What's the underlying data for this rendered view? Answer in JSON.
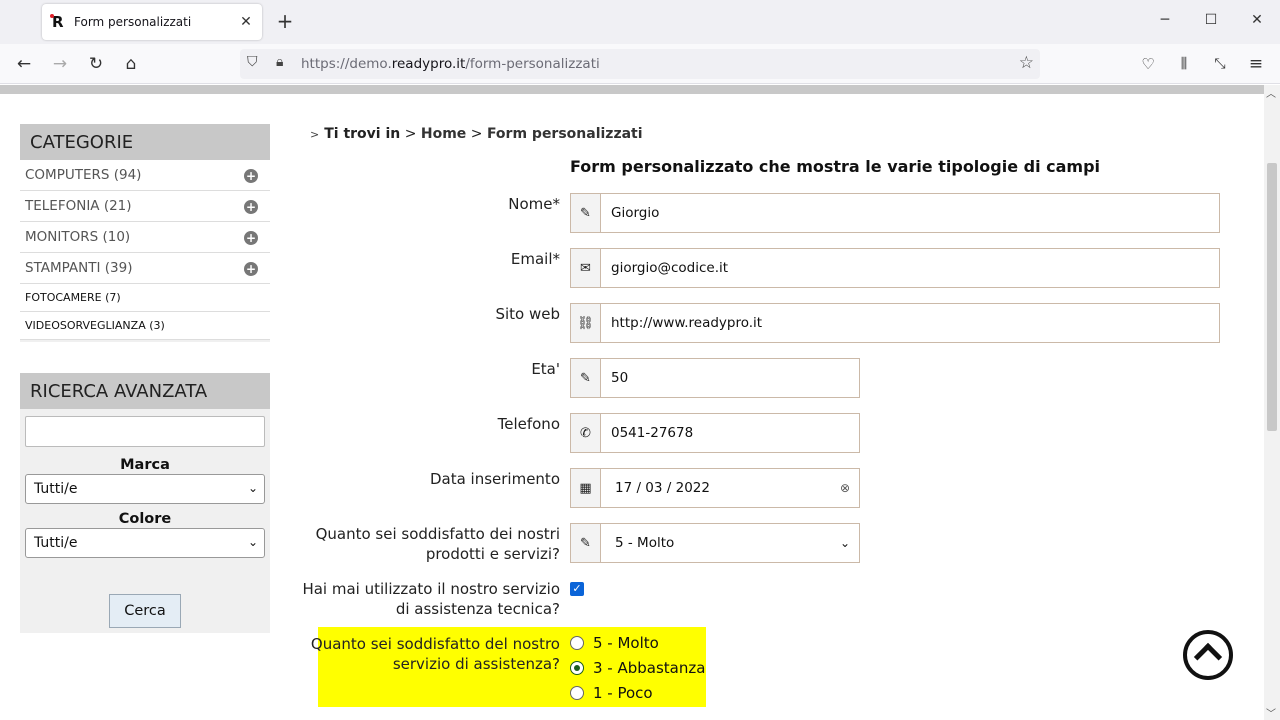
{
  "browser": {
    "tab_title": "Form personalizzati",
    "new_tab": "+",
    "close_tab": "✕",
    "url_prefix": "https://demo.",
    "url_domain": "readypro.it",
    "url_path": "/form-personalizzati"
  },
  "sidebar": {
    "categories_title": "CATEGORIE",
    "categories": [
      {
        "label": "COMPUTERS (94)"
      },
      {
        "label": "TELEFONIA (21)"
      },
      {
        "label": "MONITORS (10)"
      },
      {
        "label": "STAMPANTI (39)"
      },
      {
        "label": "FOTOCAMERE (7)"
      },
      {
        "label": "VIDEOSORVEGLIANZA (3)"
      }
    ],
    "advanced_title": "RICERCA AVANZATA",
    "brand_label": "Marca",
    "brand_value": "Tutti/e",
    "color_label": "Colore",
    "color_value": "Tutti/e",
    "search_button": "Cerca"
  },
  "breadcrumb": {
    "prefix": "Ti trovi in",
    "sep": ">",
    "home": "Home",
    "current": "Form personalizzati"
  },
  "form": {
    "title": "Form personalizzato che mostra le varie tipologie di campi",
    "name_label": "Nome*",
    "name_value": "Giorgio",
    "email_label": "Email*",
    "email_value": "giorgio@codice.it",
    "website_label": "Sito web",
    "website_value": "http://www.readypro.it",
    "age_label": "Eta'",
    "age_value": "50",
    "phone_label": "Telefono",
    "phone_value": "0541-27678",
    "date_label": "Data inserimento",
    "date_value": "17 / 03 / 2022",
    "satisfaction_label_1": "Quanto sei soddisfatto dei nostri",
    "satisfaction_label_2": "prodotti e servizi?",
    "satisfaction_value": "5 - Molto",
    "support_used_label_1": "Hai mai utilizzato il nostro servizio",
    "support_used_label_2": "di assistenza tecnica?",
    "support_used_checked": true,
    "support_rating_label_1": "Quanto sei soddisfatto del nostro",
    "support_rating_label_2": "servizio di assistenza?",
    "support_options": [
      {
        "label": "5 - Molto",
        "selected": false
      },
      {
        "label": "3 - Abbastanza",
        "selected": true
      },
      {
        "label": "1 - Poco",
        "selected": false
      }
    ]
  },
  "colors": {
    "highlight": "#ffff00",
    "sidebar_header": "#c8c8c8",
    "checkbox": "#0a64d8"
  }
}
